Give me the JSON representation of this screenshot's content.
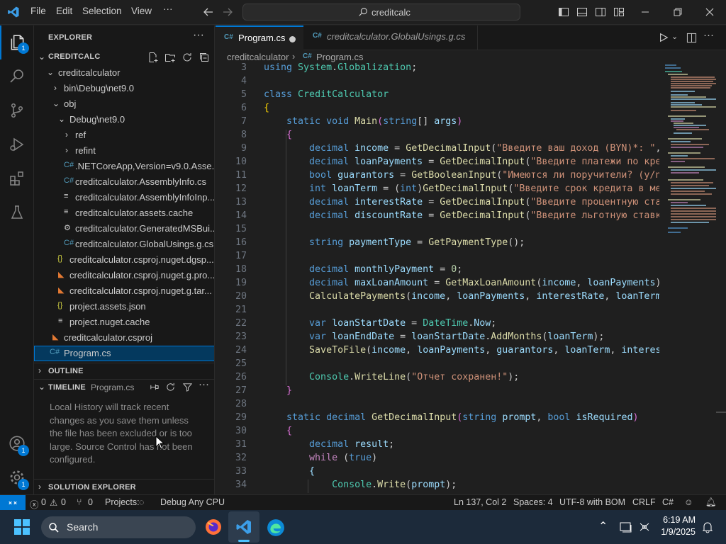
{
  "titlebar": {
    "menu": [
      "File",
      "Edit",
      "Selection",
      "View",
      "···"
    ],
    "search": "creditcalc"
  },
  "activity": {
    "explorer_badge": "1",
    "accounts_badge": "1",
    "manage_badge": "1"
  },
  "explorer": {
    "header": "EXPLORER",
    "project": "CREDITCALC",
    "tree": [
      {
        "label": "creditcalculator"
      },
      {
        "label": "bin\\Debug\\net9.0"
      },
      {
        "label": "obj"
      },
      {
        "label": "Debug\\net9.0"
      },
      {
        "label": "ref"
      },
      {
        "label": "refint"
      },
      {
        "label": ".NETCoreApp,Version=v9.0.Asse..."
      },
      {
        "label": "creditcalculator.AssemblyInfo.cs"
      },
      {
        "label": "creditcalculator.AssemblyInfoInp..."
      },
      {
        "label": "creditcalculator.assets.cache"
      },
      {
        "label": "creditcalculator.GeneratedMSBui..."
      },
      {
        "label": "creditcalculator.GlobalUsings.g.cs"
      },
      {
        "label": "creditcalculator.csproj.nuget.dgsp..."
      },
      {
        "label": "creditcalculator.csproj.nuget.g.pro..."
      },
      {
        "label": "creditcalculator.csproj.nuget.g.tar..."
      },
      {
        "label": "project.assets.json"
      },
      {
        "label": "project.nuget.cache"
      },
      {
        "label": "creditcalculator.csproj"
      },
      {
        "label": "Program.cs"
      }
    ],
    "outline": "OUTLINE",
    "timeline": "TIMELINE",
    "timeline_file": "Program.cs",
    "timeline_msg": [
      "Local History will track recent",
      "changes as you save them unless",
      "the file has been excluded or is too",
      "large. Source Control has not been",
      "configured."
    ],
    "solution": "SOLUTION EXPLORER"
  },
  "editor": {
    "tabs": [
      {
        "label": "Program.cs"
      },
      {
        "label": "creditcalculator.GlobalUsings.g.cs"
      }
    ],
    "breadcrumb": [
      "creditcalculator",
      "Program.cs"
    ],
    "line_numbers": [
      "3",
      "4",
      "5",
      "6",
      "7",
      "8",
      "9",
      "10",
      "11",
      "12",
      "13",
      "14",
      "15",
      "16",
      "17",
      "18",
      "19",
      "20",
      "21",
      "22",
      "23",
      "24",
      "25",
      "26",
      "27",
      "28",
      "29",
      "30",
      "31",
      "32",
      "33",
      "34"
    ]
  },
  "status": {
    "errors": "0",
    "warnings": "0",
    "ports": "0",
    "projects": "Projects:",
    "config": "Debug Any CPU",
    "position": "Ln 137, Col 2",
    "spaces": "Spaces: 4",
    "encoding": "UTF-8 with BOM",
    "eol": "CRLF",
    "lang": "C#"
  },
  "taskbar": {
    "search": "Search",
    "time": "6:19 AM",
    "date": "1/9/2025"
  },
  "colors": {
    "accent": "#0078d4",
    "selection": "#04395e"
  }
}
